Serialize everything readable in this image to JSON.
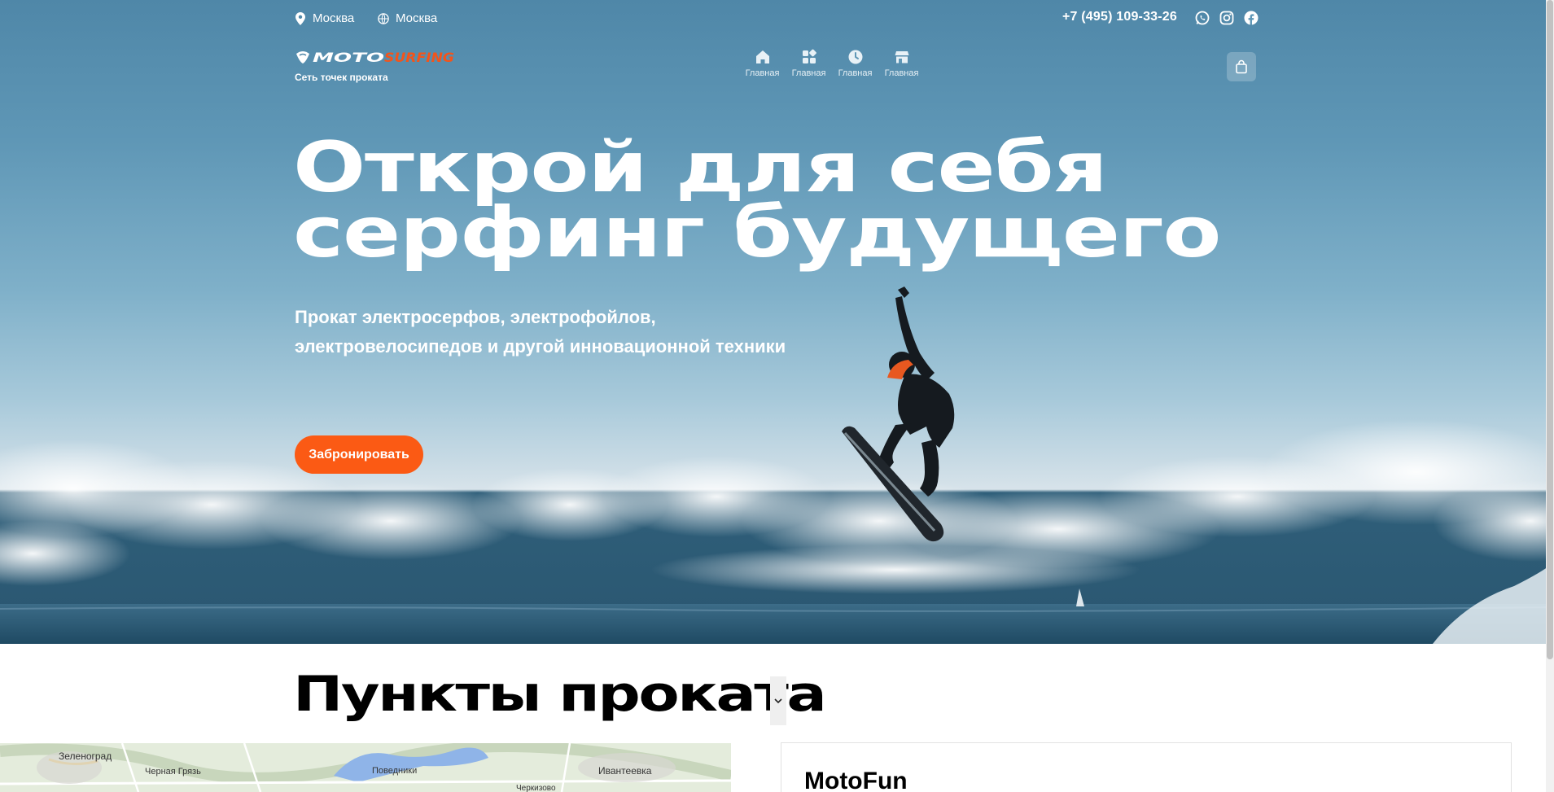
{
  "header": {
    "locations": [
      {
        "label": "Москва",
        "icon": "map-pin-icon"
      },
      {
        "label": "Москва",
        "icon": "globe-icon"
      }
    ],
    "phone": "+7 (495) 109-33-26",
    "socials": [
      "whatsapp-icon",
      "instagram-icon",
      "facebook-icon"
    ],
    "logo_text": "MOTOSURFING",
    "logo_tagline": "Сеть точек проката",
    "nav": [
      {
        "label": "Главная",
        "icon": "home-icon"
      },
      {
        "label": "Главная",
        "icon": "grid-icon"
      },
      {
        "label": "Главная",
        "icon": "clock-icon"
      },
      {
        "label": "Главная",
        "icon": "store-icon"
      }
    ],
    "cart_icon": "shopping-bag-icon"
  },
  "hero": {
    "headline_line1": "Открой для себя",
    "headline_line2": "серфинг будущего",
    "subhead_line1": "Прокат электросерфов, электрофойлов,",
    "subhead_line2": "электровелосипедов и другой инновационной техники",
    "cta": "Забронировать"
  },
  "rental_points": {
    "title": "Пункты проката",
    "map_labels": [
      "Зеленоград",
      "Черная Грязь",
      "Поведники",
      "Ивантеевка",
      "Черкизово"
    ],
    "card_title": "MotoFun"
  },
  "colors": {
    "accent": "#fb5a14",
    "sky": "#5f97b6",
    "sea": "#2a5670"
  }
}
